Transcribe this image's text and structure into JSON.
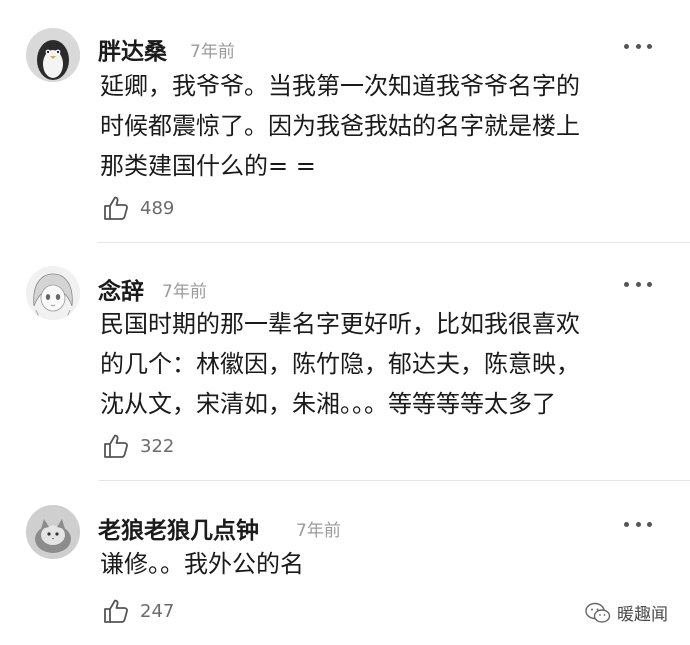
{
  "comments": [
    {
      "username": "胖达桑",
      "time": "7年前",
      "lines": [
        "延卿，我爷爷。当我第一次知道我爷爷名字的",
        "时候都震惊了。因为我爸我姑的名字就是楼上",
        "那类建国什么的= ="
      ],
      "likes": "489",
      "avatar_icon": "penguin-avatar-icon"
    },
    {
      "username": "念辞",
      "time": "7年前",
      "lines": [
        "民国时期的那一辈名字更好听，比如我很喜欢",
        "的几个：林徽因，陈竹隐，郁达夫，陈意映，",
        "沈从文，宋清如，朱湘。。。等等等等太多了"
      ],
      "likes": "322",
      "avatar_icon": "anime-girl-avatar-icon"
    },
    {
      "username": "老狼老狼几点钟",
      "time": "7年前",
      "lines": [
        "谦修。。我外公的名"
      ],
      "likes": "247",
      "avatar_icon": "cat-avatar-icon"
    }
  ],
  "icons": {
    "more": "more-dots-icon",
    "like": "thumbs-up-icon"
  },
  "watermark": {
    "label": "暖趣闻",
    "icon": "wechat-logo-icon"
  },
  "colors": {
    "username": "#1b1b1b",
    "secondary": "#9b9b9b",
    "divider": "#e6e6e6"
  }
}
